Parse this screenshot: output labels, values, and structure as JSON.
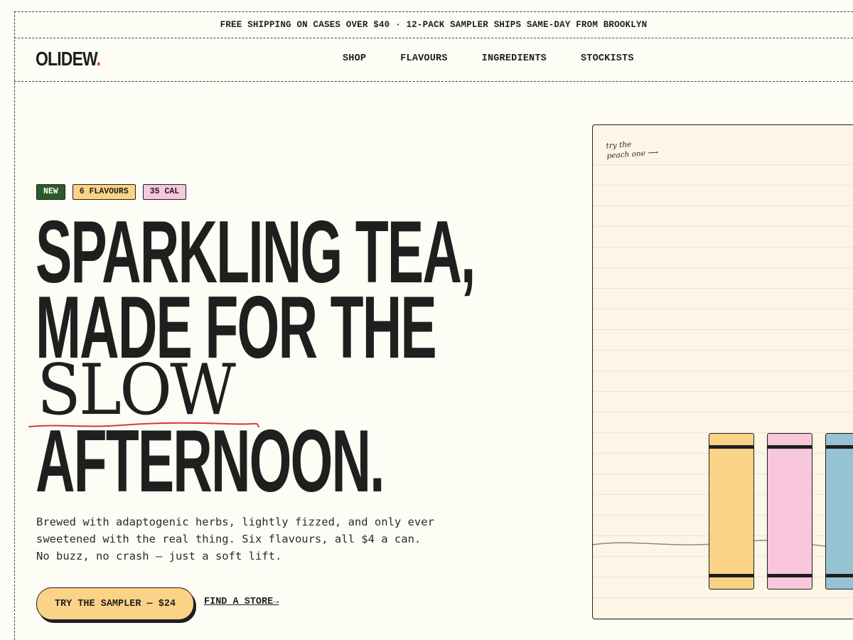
{
  "announcement": "FREE SHIPPING ON CASES OVER $40 · 12-PACK SAMPLER SHIPS SAME-DAY FROM BROOKLYN",
  "brand": {
    "name": "OLIDEW",
    "dot": ".",
    "accent": "#d63a2f"
  },
  "nav": {
    "items": [
      "SHOP",
      "FLAVOURS",
      "INGREDIENTS",
      "STOCKISTS"
    ]
  },
  "hero": {
    "tags": [
      {
        "label": "NEW",
        "color": "#2c5a2a"
      },
      {
        "label": "6 FLAVOURS",
        "color": "#fbd387"
      },
      {
        "label": "35 CAL",
        "color": "#f8c7dc"
      }
    ],
    "headline": {
      "line1": "SPARKLING TEA,",
      "line2": "MADE FOR THE",
      "line3": "SLOW",
      "line4": "AFTERNOON."
    },
    "description": "Brewed with adaptogenic herbs, lightly fizzed, and only ever sweetened with the real thing. Six flavours, all $4 a can. No buzz, no crash — just a soft lift.",
    "cta_primary": "TRY THE SAMPLER — $24",
    "cta_secondary": "FIND A STORE→"
  },
  "panel": {
    "note_line1": "try the",
    "note_line2": "peach one ⟶",
    "cans": [
      {
        "color": "#fbd387",
        "icon": "can-illustration"
      },
      {
        "color": "#f8c7dc",
        "icon": "can-illustration"
      },
      {
        "color": "#95c3d2",
        "icon": "can-illustration"
      }
    ]
  },
  "colors": {
    "background": "#fefdf5",
    "ink": "#1f1f1f",
    "cta": "#fbd387",
    "panel_bg": "#fdf6e7"
  }
}
